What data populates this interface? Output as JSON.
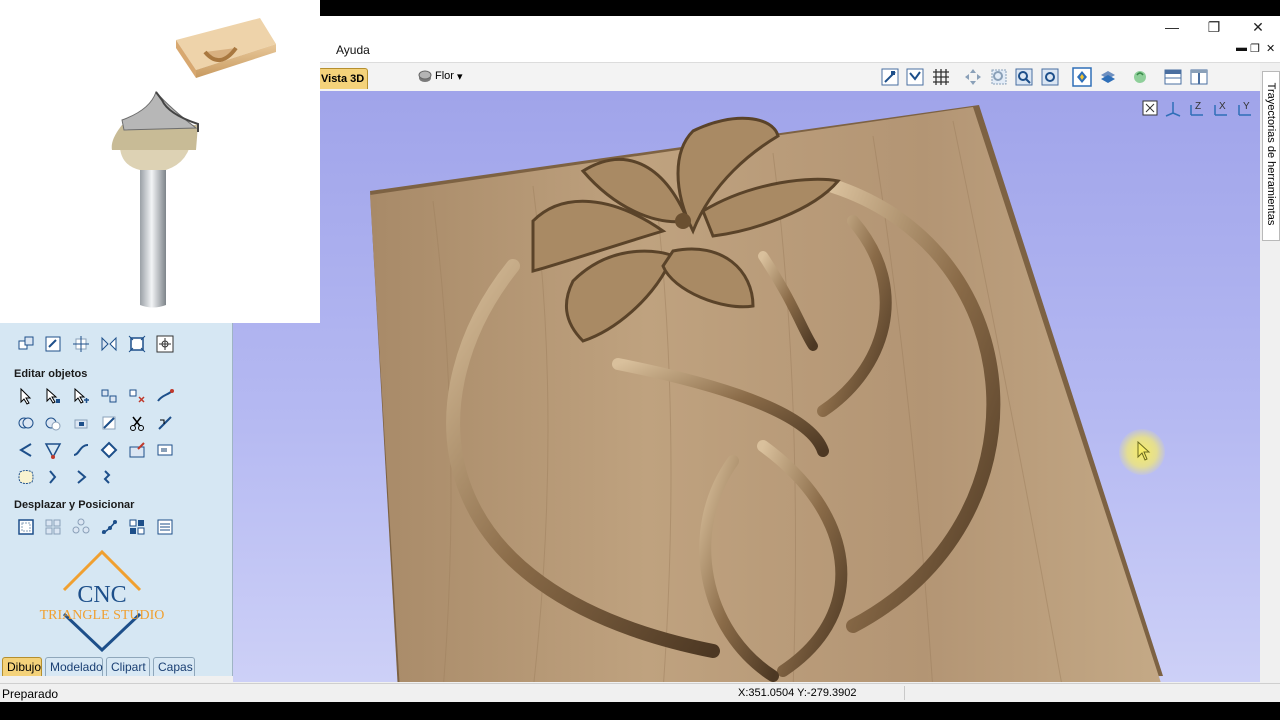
{
  "menu": {
    "help": "Ayuda"
  },
  "window_controls": {
    "minimize": "—",
    "maximize": "❐",
    "close": "✕"
  },
  "mdi_controls": {
    "minimize": "▬",
    "restore": "❐",
    "close": "✕"
  },
  "view_tab": {
    "label": "Vista 3D"
  },
  "model_dropdown": {
    "value": "Flor",
    "arrow": "▾"
  },
  "toolbar_icons": [
    "top-view-icon",
    "iso-view-icon",
    "grid-icon",
    "pan-icon",
    "zoom-box-icon",
    "zoom-in-icon",
    "zoom-fit-icon",
    "toolpath-view-icon",
    "material-icon",
    "render-icon",
    "layout-icon",
    "split-view-icon"
  ],
  "axis_controls": [
    "fit-icon",
    "axis-icon",
    "z-axis-icon",
    "x-axis-icon",
    "y-axis-icon"
  ],
  "sidebar": {
    "section_edit": "Editar objetos",
    "section_move": "Desplazar y Posicionar"
  },
  "bottom_tabs": [
    "Dibujo",
    "Modelado",
    "Clipart",
    "Capas"
  ],
  "status": {
    "text": "Preparado",
    "coords": "X:351.0504 Y:-279.3902"
  },
  "right_panel": {
    "label": "Trayectorias de herramientas"
  },
  "logo": {
    "line1": "CNC",
    "line2": "TRIANGLE STUDIO"
  },
  "colors": {
    "active_tab": "#f4d27a",
    "sidebar_bg": "#d6e7f3",
    "logo_orange": "#f0a030",
    "logo_blue": "#1d4f8a",
    "wood": "#b69774"
  }
}
